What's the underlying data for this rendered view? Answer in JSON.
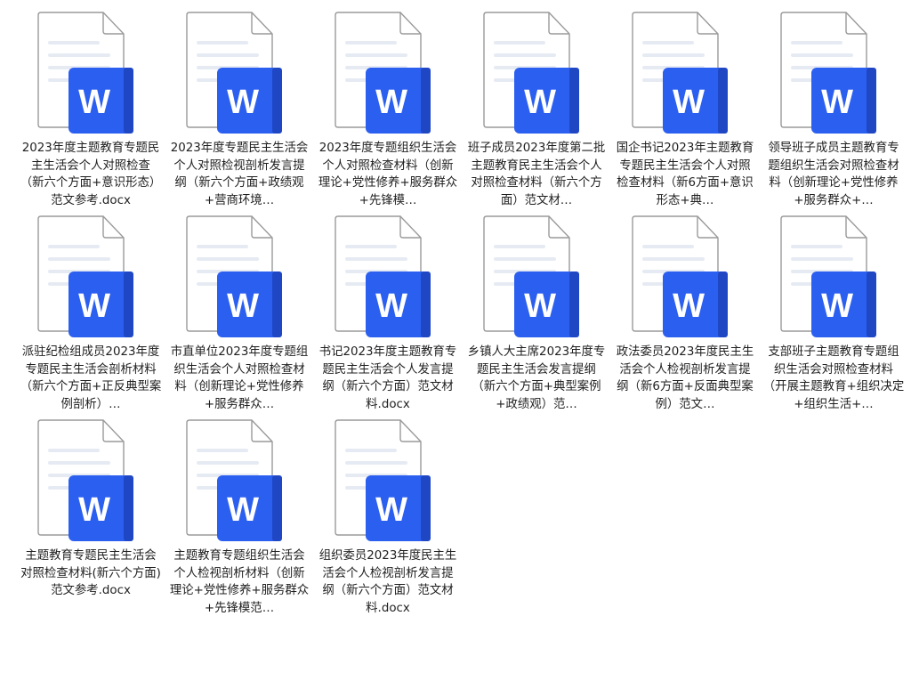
{
  "icon": {
    "name": "word-document-icon",
    "letter": "W",
    "badge_color": "#2b5ff0",
    "badge_shade": "#1f47c4",
    "page_color": "#ffffff",
    "page_border": "#9a9a9a",
    "line_color": "#e6ebf3"
  },
  "files": [
    {
      "name": "2023年度主题教育专题民主生活会个人对照检查（新六个方面+意识形态）范文参考.docx"
    },
    {
      "name": "2023年度专题民主生活会个人对照检视剖析发言提纲（新六个方面+政绩观+营商环境…"
    },
    {
      "name": "2023年度专题组织生活会个人对照检查材料（创新理论+党性修养+服务群众+先锋模…"
    },
    {
      "name": "班子成员2023年度第二批主题教育民主生活会个人对照检查材料（新六个方面）范文材…"
    },
    {
      "name": "国企书记2023年主题教育专题民主生活会个人对照检查材料（新6方面+意识形态+典…"
    },
    {
      "name": "领导班子成员主题教育专题组织生活会对照检查材料（创新理论+党性修养+服务群众+…"
    },
    {
      "name": "派驻纪检组成员2023年度专题民主生活会剖析材料（新六个方面+正反典型案例剖析）…"
    },
    {
      "name": "市直单位2023年度专题组织生活会个人对照检查材料（创新理论+党性修养+服务群众…"
    },
    {
      "name": "书记2023年度主题教育专题民主生活会个人发言提纲（新六个方面）范文材料.docx"
    },
    {
      "name": "乡镇人大主席2023年度专题民主生活会发言提纲（新六个方面+典型案例+政绩观）范…"
    },
    {
      "name": "政法委员2023年度民主生活会个人检视剖析发言提纲（新6方面+反面典型案例）范文…"
    },
    {
      "name": "支部班子主题教育专题组织生活会对照检查材料（开展主题教育+组织决定+组织生活+…"
    },
    {
      "name": "主题教育专题民主生活会对照检查材料(新六个方面)范文参考.docx"
    },
    {
      "name": "主题教育专题组织生活会个人检视剖析材料（创新理论+党性修养+服务群众+先锋模范…"
    },
    {
      "name": "组织委员2023年度民主生活会个人检视剖析发言提纲（新六个方面）范文材料.docx"
    }
  ]
}
